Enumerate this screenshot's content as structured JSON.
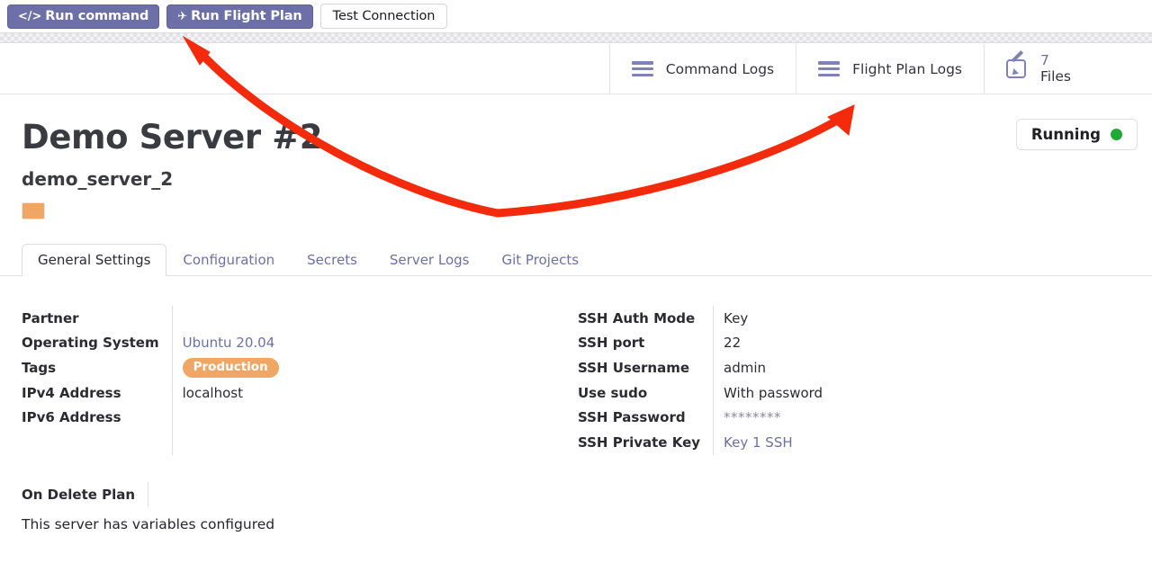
{
  "toolbar": {
    "run_command": {
      "label": "Run command",
      "glyph": "</>"
    },
    "run_flight_plan": {
      "label": "Run Flight Plan",
      "glyph": "✈"
    },
    "test_connection": {
      "label": "Test Connection"
    }
  },
  "logs_bar": {
    "command_logs": {
      "label": "Command Logs",
      "icon": "hamburger-icon"
    },
    "flight_plan_logs": {
      "label": "Flight Plan Logs",
      "icon": "hamburger-icon"
    },
    "files": {
      "count": "7",
      "label": "Files",
      "icon": "pencil-square-icon"
    }
  },
  "header": {
    "title": "Demo Server #2",
    "subtitle": "demo_server_2",
    "swatch_color": "#f0a664",
    "status": {
      "label": "Running",
      "dot_color": "#21a938"
    }
  },
  "tabs": [
    {
      "label": "General Settings",
      "active": true
    },
    {
      "label": "Configuration",
      "active": false
    },
    {
      "label": "Secrets",
      "active": false
    },
    {
      "label": "Server Logs",
      "active": false
    },
    {
      "label": "Git Projects",
      "active": false
    }
  ],
  "details_left": [
    {
      "label": "Partner",
      "value": "",
      "style": "plain"
    },
    {
      "label": "Operating System",
      "value": "Ubuntu 20.04",
      "style": "link"
    },
    {
      "label": "Tags",
      "value": "Production",
      "style": "pill"
    },
    {
      "label": "IPv4 Address",
      "value": "localhost",
      "style": "plain"
    },
    {
      "label": "IPv6 Address",
      "value": "",
      "style": "plain"
    }
  ],
  "details_right": [
    {
      "label": "SSH Auth Mode",
      "value": "Key",
      "style": "plain"
    },
    {
      "label": "SSH port",
      "value": "22",
      "style": "plain"
    },
    {
      "label": "SSH Username",
      "value": "admin",
      "style": "plain"
    },
    {
      "label": "Use sudo",
      "value": "With password",
      "style": "plain"
    },
    {
      "label": "SSH Password",
      "value": "********",
      "style": "muted"
    },
    {
      "label": "SSH Private Key",
      "value": "Key 1 SSH",
      "style": "link"
    }
  ],
  "footer": {
    "on_delete_plan_label": "On Delete Plan",
    "on_delete_plan_value": "",
    "variables_note": "This server has variables configured"
  },
  "annotation": {
    "color": "#f32b0c"
  }
}
